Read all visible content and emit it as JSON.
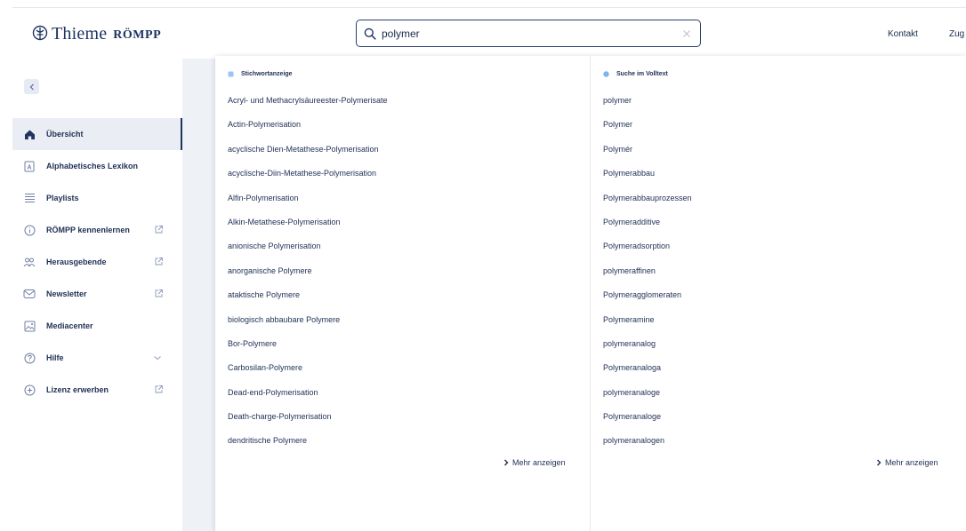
{
  "header": {
    "brand": "Thieme",
    "brand_sub": "RÖMPP",
    "search_value": "polymer",
    "nav": [
      "Kontakt",
      "Zug"
    ]
  },
  "sidebar": {
    "items": [
      {
        "label": "Übersicht",
        "icon": "home-icon",
        "active": true
      },
      {
        "label": "Alphabetisches Lexikon",
        "icon": "lexicon-icon"
      },
      {
        "label": "Playlists",
        "icon": "playlist-icon"
      },
      {
        "label": "RÖMPP kennenlernen",
        "icon": "info-icon",
        "external": true
      },
      {
        "label": "Herausgebende",
        "icon": "people-icon",
        "external": true
      },
      {
        "label": "Newsletter",
        "icon": "mail-icon",
        "external": true
      },
      {
        "label": "Mediacenter",
        "icon": "media-icon"
      },
      {
        "label": "Hilfe",
        "icon": "help-icon",
        "expandable": true
      },
      {
        "label": "Lizenz erwerben",
        "icon": "plus-circle-icon",
        "external": true
      }
    ]
  },
  "dropdown": {
    "keywords": {
      "heading": "Stichwortanzeige",
      "items": [
        "Acryl- und Methacrylsäureester-Polymerisate",
        "Actin-Polymerisation",
        "acyclische Dien-Metathese-Polymerisation",
        "acyclische-Diin-Metathese-Polymerisation",
        "Alfin-Polymerisation",
        "Alkin-Metathese-Polymerisation",
        "anionische Polymerisation",
        "anorganische Polymere",
        "ataktische Polymere",
        "biologisch abbaubare Polymere",
        "Bor-Polymere",
        "Carbosilan-Polymere",
        "Dead-end-Polymerisation",
        "Death-charge-Polymerisation",
        "dendritische Polymere"
      ],
      "more": "Mehr anzeigen"
    },
    "fulltext": {
      "heading": "Suche im Volltext",
      "items": [
        "polymer",
        "Polymer",
        "Polymér",
        "Polymerabbau",
        "Polymerabbauprozessen",
        "Polymeradditive",
        "Polymeradsorption",
        "polymeraffinen",
        "Polymeragglomeraten",
        "Polymeramine",
        "polymeranalog",
        "Polymeranaloga",
        "polymeranaloge",
        "Polymeranaloge",
        "polymeranalogen"
      ],
      "more": "Mehr anzeigen"
    }
  },
  "colors": {
    "primary": "#1e3461",
    "active_bg": "#eaedf3",
    "dot_keyword": "#9ec3f0",
    "dot_fulltext": "#7fb2ee"
  }
}
